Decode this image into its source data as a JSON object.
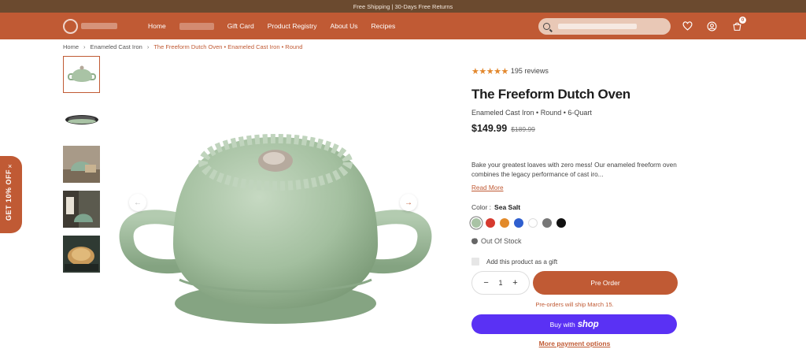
{
  "announcement": "Free Shipping | 30-Days Free Returns",
  "nav": {
    "links": [
      "Home",
      "Gift Card",
      "Product Registry",
      "About Us",
      "Recipes"
    ],
    "cart_count": "0"
  },
  "breadcrumb": [
    "Home",
    "Enameled Cast Iron",
    "The Freeform Dutch Oven • Enameled Cast Iron • Round"
  ],
  "promo": {
    "label": "GET 10% OFF",
    "close": "×"
  },
  "product": {
    "rating_stars": "★★★★★",
    "reviews": "195 reviews",
    "title": "The Freeform Dutch Oven",
    "subtitle": "Enameled Cast Iron • Round • 6-Quart",
    "price": "$149.99",
    "compare_price": "$189.99",
    "description": "Bake your greatest loaves with zero mess! Our enameled freeform oven combines the legacy performance of cast iro...",
    "read_more": "Read More",
    "color_label": "Color :",
    "color_value": "Sea Salt",
    "swatches": [
      "#a9c3a5",
      "#d63a2f",
      "#e28a2a",
      "#2f5fcf",
      "#ffffff",
      "#777777",
      "#111111"
    ],
    "stock": "Out Of Stock",
    "gift_label": "Add this product as a gift",
    "qty": "1",
    "qty_minus": "−",
    "qty_plus": "+",
    "preorder": "Pre Order",
    "ship_note": "Pre-orders will ship March 15.",
    "shop_prefix": "Buy with",
    "shop_brand": "shop",
    "more_payment": "More payment options"
  },
  "colors": {
    "brand": "#c05a34",
    "topbar": "#6b4a2f",
    "shop": "#5a31f4",
    "pot": "#a9c3a5"
  }
}
